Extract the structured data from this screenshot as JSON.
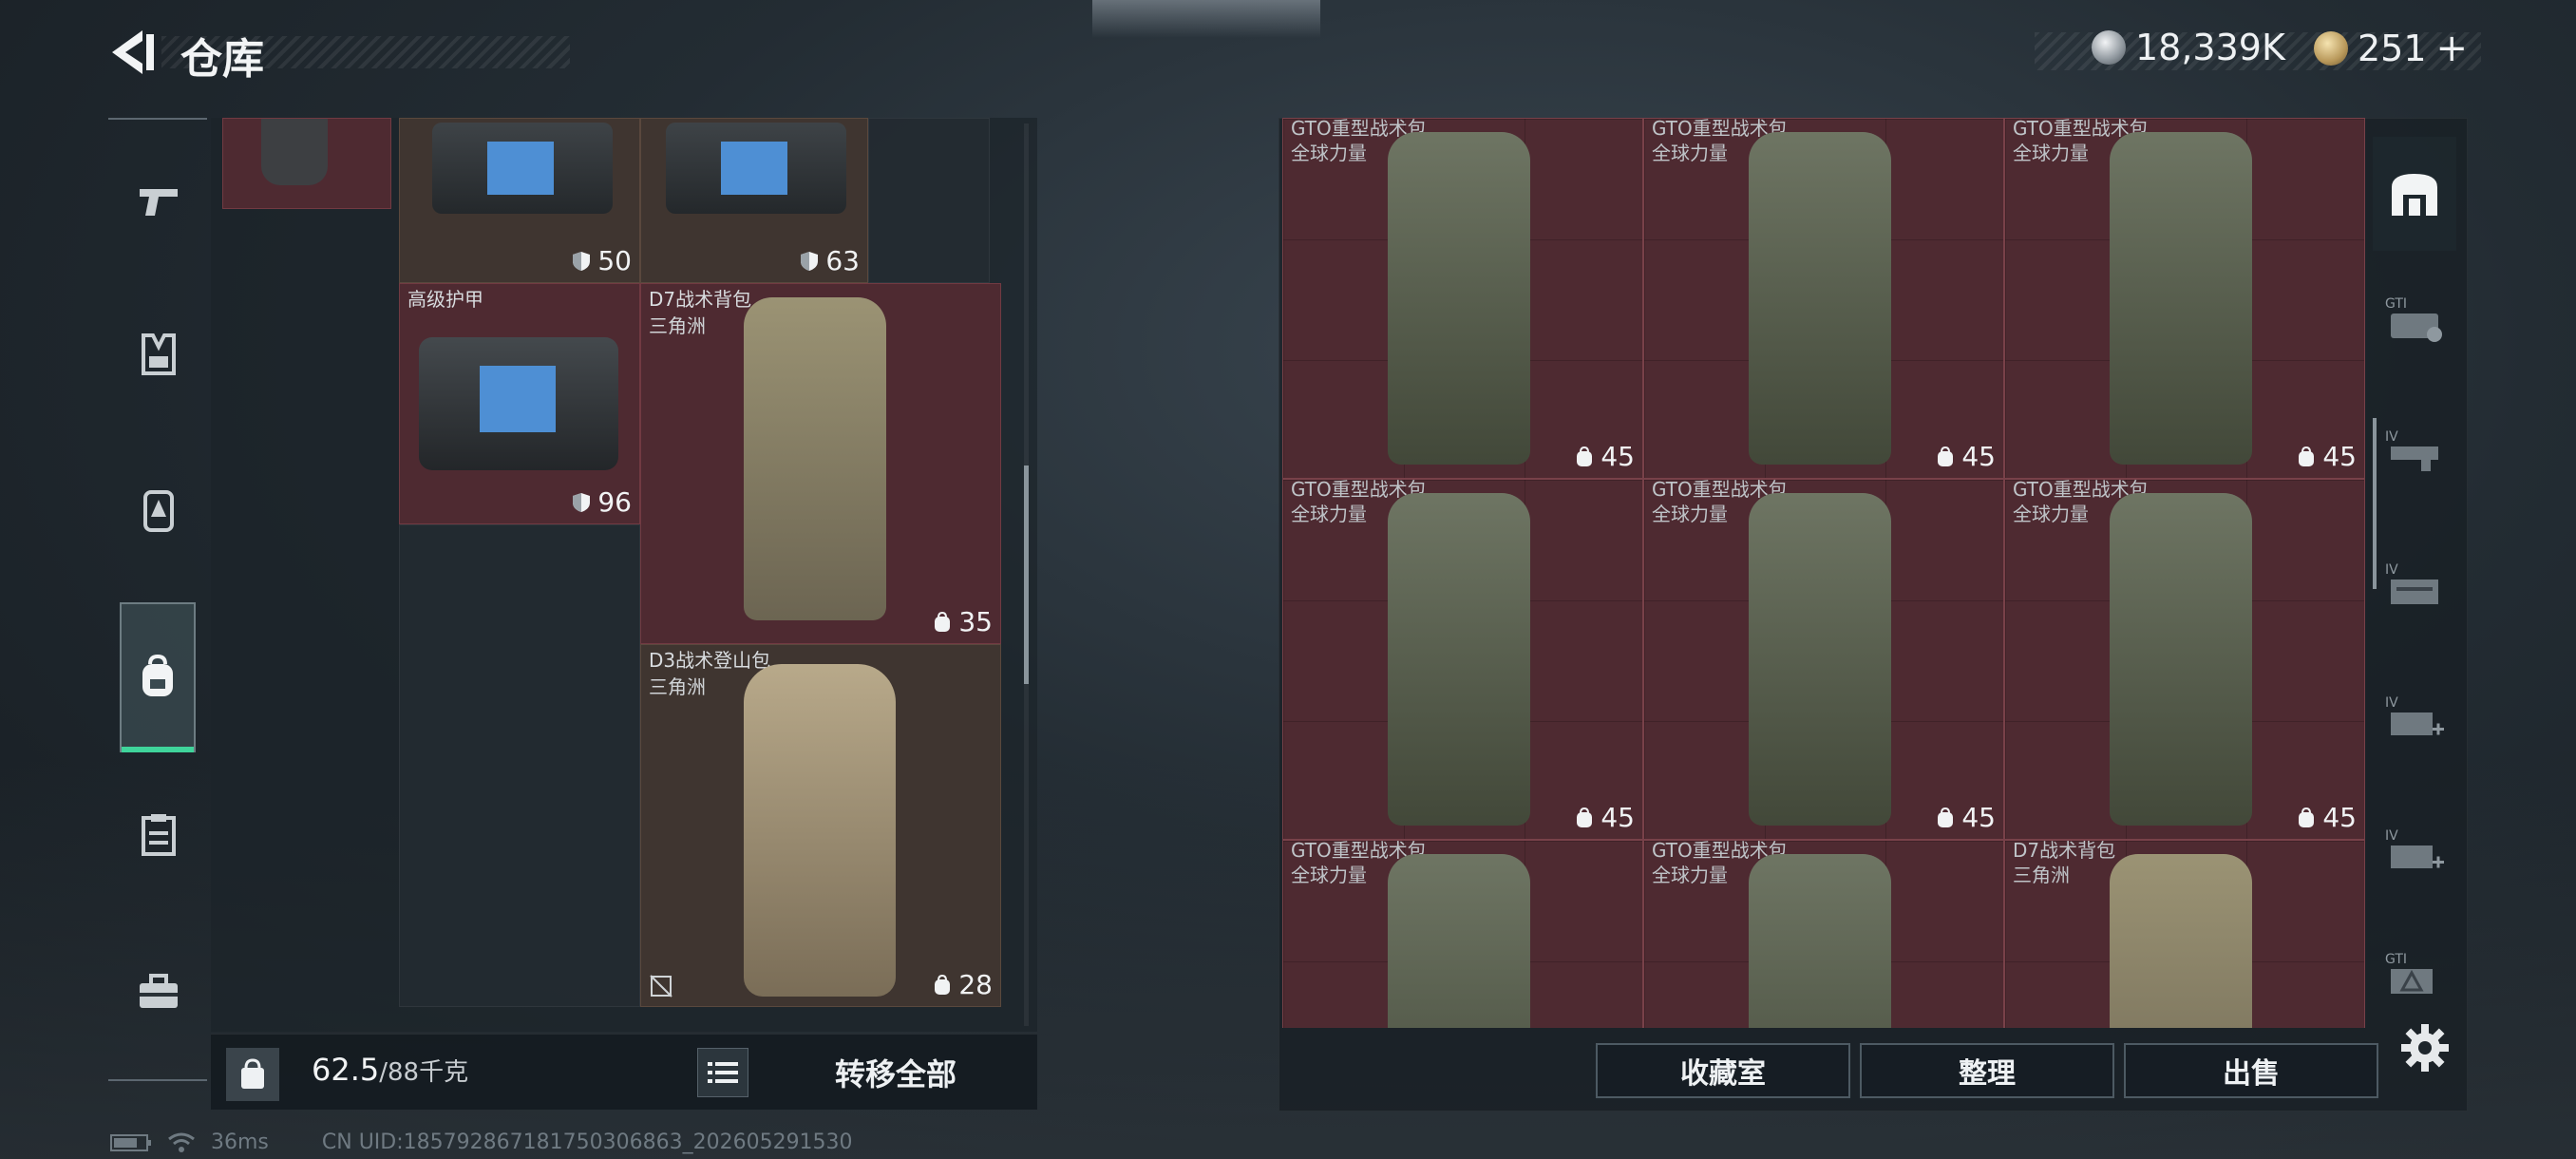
{
  "header": {
    "title": "仓库",
    "currency_silver": "18,339K",
    "currency_gold": "251",
    "currency_gold_plus": "+"
  },
  "rail": {
    "items": [
      {
        "name": "weapons"
      },
      {
        "name": "vests"
      },
      {
        "name": "armor"
      },
      {
        "name": "backpacks"
      },
      {
        "name": "consumables"
      },
      {
        "name": "toolbox"
      }
    ],
    "active": "backpacks"
  },
  "storage": {
    "items": [
      {
        "name": "",
        "sub": "",
        "stat_type": "armor",
        "stat": "50"
      },
      {
        "name": "",
        "sub": "",
        "stat_type": "armor",
        "stat": "63"
      },
      {
        "name": "高级护甲",
        "sub": "",
        "stat_type": "armor",
        "stat": "96"
      },
      {
        "name": "D7战术背包",
        "sub": "三角洲",
        "stat_type": "bag",
        "stat": "35"
      },
      {
        "name": "D3战术登山包",
        "sub": "三角洲",
        "stat_type": "bag",
        "stat": "28"
      }
    ],
    "weight_current": "62.5",
    "weight_capacity": "/88千克",
    "transfer_all": "转移全部"
  },
  "stash": {
    "items": [
      {
        "name": "GTO重型战术包",
        "sub": "全球力量",
        "stat": "45"
      },
      {
        "name": "GTO重型战术包",
        "sub": "全球力量",
        "stat": "45"
      },
      {
        "name": "GTO重型战术包",
        "sub": "全球力量",
        "stat": "45"
      },
      {
        "name": "GTO重型战术包",
        "sub": "全球力量",
        "stat": "45"
      },
      {
        "name": "GTO重型战术包",
        "sub": "全球力量",
        "stat": "45"
      },
      {
        "name": "GTO重型战术包",
        "sub": "全球力量",
        "stat": "45"
      },
      {
        "name": "GTO重型战术包",
        "sub": "全球力量",
        "stat": ""
      },
      {
        "name": "GTO重型战术包",
        "sub": "全球力量",
        "stat": ""
      },
      {
        "name": "D7战术背包",
        "sub": "三角洲",
        "stat": ""
      }
    ],
    "tabs": [
      {
        "label": ""
      },
      {
        "label": "GTI"
      },
      {
        "label": "IV"
      },
      {
        "label": "IV"
      },
      {
        "label": "IV"
      },
      {
        "label": "IV"
      },
      {
        "label": "GTI"
      }
    ],
    "buttons": {
      "collection": "收藏室",
      "organize": "整理",
      "sell": "出售"
    }
  },
  "status": {
    "ping": "36ms",
    "uid": "CN UID:18579286718175030686​3_202605291530"
  },
  "colors": {
    "accent_green": "#3fd49b",
    "cell_red": "#4e2a31",
    "cell_brown": "#3f3530"
  }
}
